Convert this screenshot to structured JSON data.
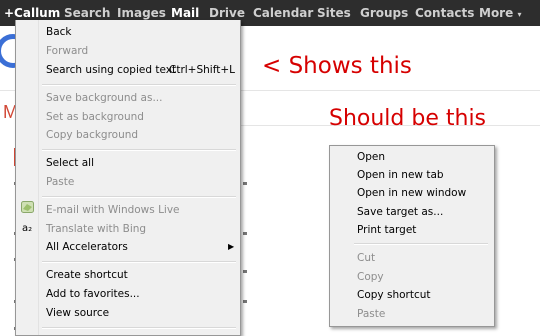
{
  "gbar": {
    "user": "+Callum",
    "items": [
      "Search",
      "Images",
      "Mail",
      "Drive",
      "Calendar",
      "Sites",
      "Groups",
      "Contacts",
      "More"
    ],
    "more_arrow": "▾",
    "active": "Mail",
    "bg_color": "#2d2d2d"
  },
  "background": {
    "mail_letter": "M"
  },
  "annotations": {
    "shows_this": "< Shows this",
    "should_be_this": "Should be this",
    "color": "#d60000"
  },
  "menu_actual": {
    "items": [
      {
        "label": "Back",
        "disabled": false
      },
      {
        "label": "Forward",
        "disabled": true
      },
      {
        "label": "Search using copied text",
        "disabled": false,
        "shortcut": "Ctrl+Shift+L"
      },
      {
        "label": "Save background as...",
        "disabled": true
      },
      {
        "label": "Set as background",
        "disabled": true
      },
      {
        "label": "Copy background",
        "disabled": true
      },
      {
        "label": "Select all",
        "disabled": false
      },
      {
        "label": "Paste",
        "disabled": true
      },
      {
        "label": "E-mail with Windows Live",
        "disabled": true,
        "icon": "windows-live-icon"
      },
      {
        "label": "Translate with Bing",
        "disabled": true,
        "icon": "bing-translate-icon"
      },
      {
        "label": "All Accelerators",
        "disabled": false,
        "submenu_arrow": "▶"
      },
      {
        "label": "Create shortcut",
        "disabled": false
      },
      {
        "label": "Add to favorites...",
        "disabled": false
      },
      {
        "label": "View source",
        "disabled": false
      }
    ],
    "bing_icon_glyph": "a₂"
  },
  "menu_expected": {
    "items": [
      {
        "label": "Open",
        "disabled": false
      },
      {
        "label": "Open in new tab",
        "disabled": false
      },
      {
        "label": "Open in new window",
        "disabled": false
      },
      {
        "label": "Save target as...",
        "disabled": false
      },
      {
        "label": "Print target",
        "disabled": false
      },
      {
        "label": "Cut",
        "disabled": true
      },
      {
        "label": "Copy",
        "disabled": true
      },
      {
        "label": "Copy shortcut",
        "disabled": false
      },
      {
        "label": "Paste",
        "disabled": true
      }
    ]
  }
}
